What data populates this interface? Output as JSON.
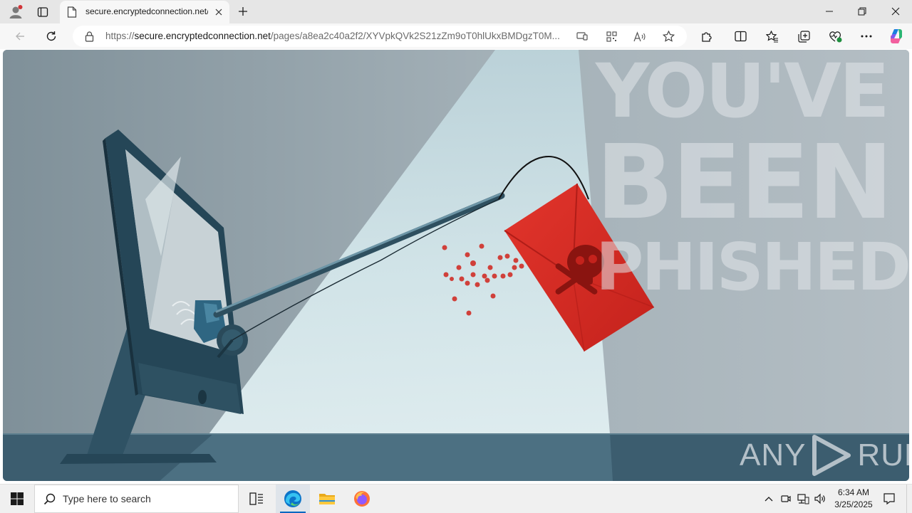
{
  "browser": {
    "tab": {
      "title": "secure.encryptedconnection.net/"
    },
    "address": {
      "scheme": "https://",
      "host": "secure.encryptedconnection.net",
      "path": "/pages/a8ea2c40a2f2/XYVpkQVk2S21zZm9oT0hlUkxBMDgzT0M..."
    }
  },
  "page": {
    "headline": {
      "line1": "YOU'VE",
      "line2": "BEEN",
      "line3": "PHISHED!"
    },
    "watermark": {
      "left": "ANY",
      "right": "RUN"
    }
  },
  "taskbar": {
    "search_placeholder": "Type here to search",
    "time": "6:34 AM",
    "date": "3/25/2025"
  },
  "colors": {
    "accent": "#0067c0",
    "envelope": "#d42a22",
    "copilot": "#1a7fe0"
  }
}
